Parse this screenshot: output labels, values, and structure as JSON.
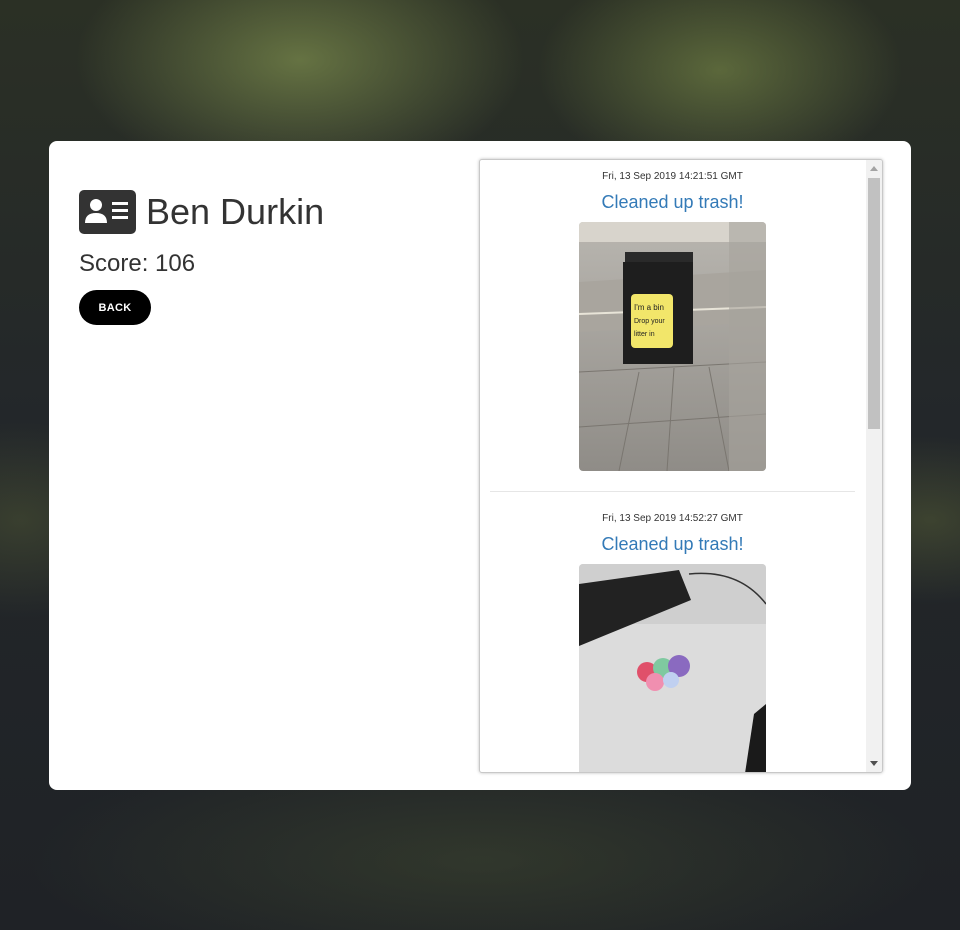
{
  "profile": {
    "icon": "id-card-icon",
    "name": "Ben Durkin",
    "score_label": "Score:",
    "score": "106",
    "back_label": "BACK"
  },
  "feed": {
    "posts": [
      {
        "date": "Fri, 13 Sep 2019 14:21:51 GMT",
        "title": "Cleaned up trash!",
        "photo_sign_text": [
          "I'm a bin",
          "Drop your",
          "litter in"
        ]
      },
      {
        "date": "Fri, 13 Sep 2019 14:52:27 GMT",
        "title": "Cleaned up trash!"
      }
    ]
  },
  "colors": {
    "link": "#337ab7",
    "button": "#000000",
    "card": "#ffffff"
  }
}
